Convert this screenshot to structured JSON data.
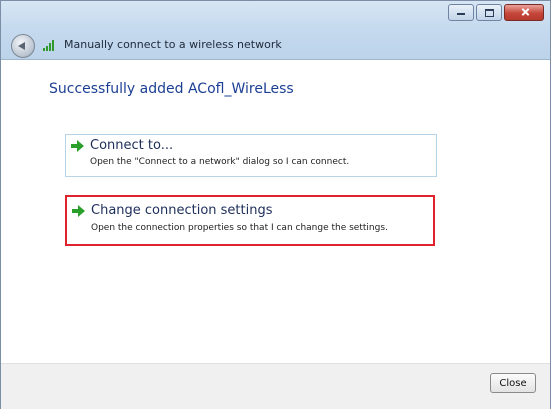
{
  "window": {
    "title": "Manually connect to a wireless network",
    "controls": [
      "minimize-icon",
      "maximize-icon",
      "close-icon"
    ]
  },
  "main": {
    "success_message": "Successfully added  ACofl_WireLess"
  },
  "options": [
    {
      "title": "Connect to...",
      "description": "Open the \"Connect to a network\" dialog so I can connect.",
      "icon": "green-arrow-icon"
    },
    {
      "title": "Change connection settings",
      "description": "Open the connection properties so that I can change the settings.",
      "icon": "green-arrow-icon",
      "highlight_color": "#e0222e"
    }
  ],
  "footer": {
    "close_label": "Close"
  },
  "colors": {
    "accent_text": "#1c3f94",
    "arrow": "#2aa02a",
    "highlight": "#e0222e"
  }
}
